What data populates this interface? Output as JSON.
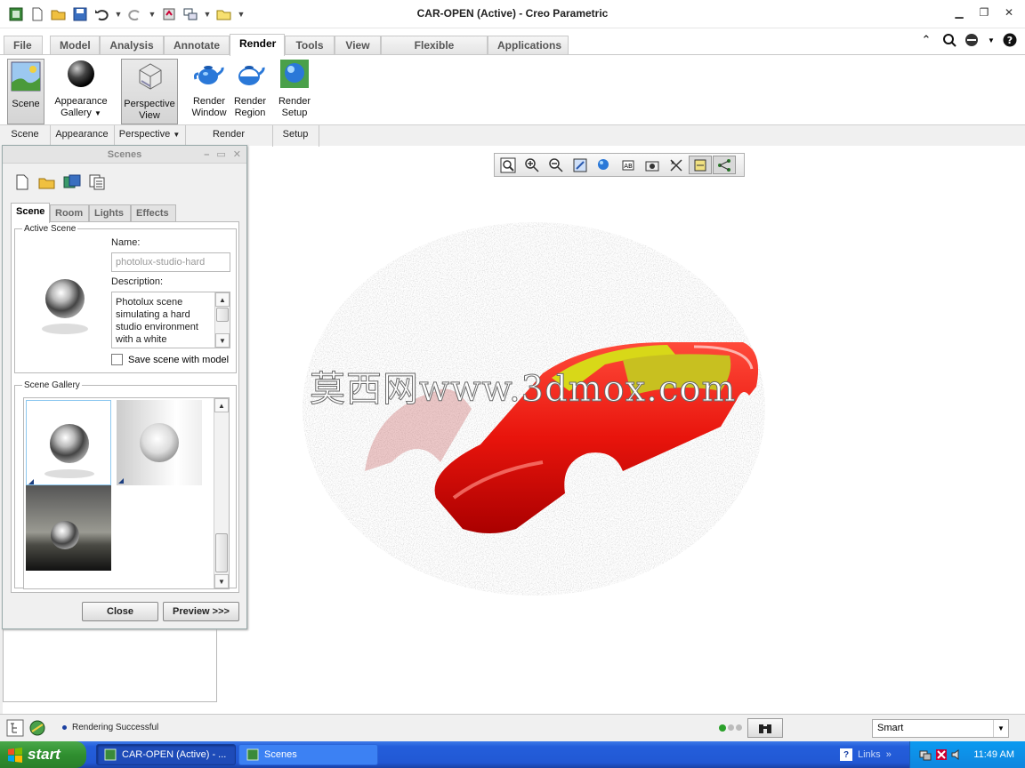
{
  "window": {
    "title": "CAR-OPEN (Active) - Creo Parametric"
  },
  "ribbon": {
    "tabs": [
      "File",
      "Model",
      "Analysis",
      "Annotate",
      "Render",
      "Tools",
      "View",
      "Flexible Modeling",
      "Applications"
    ],
    "active_tab": "Render",
    "buttons": {
      "scene": "Scene",
      "appearance_gallery_1": "Appearance",
      "appearance_gallery_2": "Gallery",
      "perspective_view_1": "Perspective",
      "perspective_view_2": "View",
      "render_window_1": "Render",
      "render_window_2": "Window",
      "render_region_1": "Render",
      "render_region_2": "Region",
      "render_setup_1": "Render",
      "render_setup_2": "Setup"
    },
    "groups": [
      "Scene",
      "Appearance",
      "Perspective",
      "Render",
      "Setup"
    ]
  },
  "dialog": {
    "title": "Scenes",
    "tabs": [
      "Scene",
      "Room",
      "Lights",
      "Effects"
    ],
    "active_tab": "Scene",
    "active_scene_legend": "Active Scene",
    "name_label": "Name:",
    "name_value": "photolux-studio-hard",
    "description_label": "Description:",
    "description_value": "Photolux scene simulating a hard studio environment with a white",
    "save_with_model_label": "Save scene with model",
    "save_with_model_checked": false,
    "gallery_legend": "Scene Gallery",
    "close_label": "Close",
    "preview_label": "Preview >>>"
  },
  "viewport": {
    "watermark": "莫西网www.3dmox.com"
  },
  "statusbar": {
    "message": "Rendering Successful",
    "filter_value": "Smart"
  },
  "taskbar": {
    "start_label": "start",
    "tasks": [
      "CAR-OPEN (Active) - ...",
      "Scenes"
    ],
    "links_label": "Links",
    "time": "11:49 AM"
  },
  "colors": {
    "car_red": "#e8140c",
    "glass_yellow": "#d8d818",
    "taskbar_blue": "#245edb",
    "start_green": "#3a9a3a"
  }
}
